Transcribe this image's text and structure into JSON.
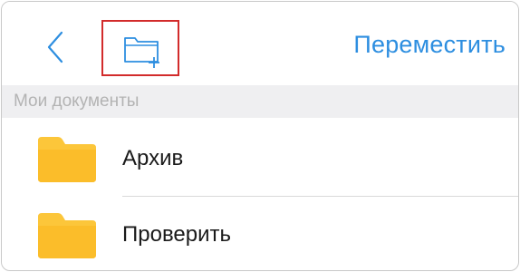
{
  "header": {
    "back_icon": "chevron-left-icon",
    "new_folder_icon": "folder-plus-icon",
    "move_label": "Переместить"
  },
  "section": {
    "title": "Мои документы"
  },
  "folders": [
    {
      "label": "Архив",
      "icon": "folder-icon"
    },
    {
      "label": "Проверить",
      "icon": "folder-icon"
    }
  ],
  "colors": {
    "accent": "#2d8ee0",
    "highlight_border": "#d22b2b",
    "folder": "#fcc63a",
    "section_bg": "#efeff1"
  }
}
